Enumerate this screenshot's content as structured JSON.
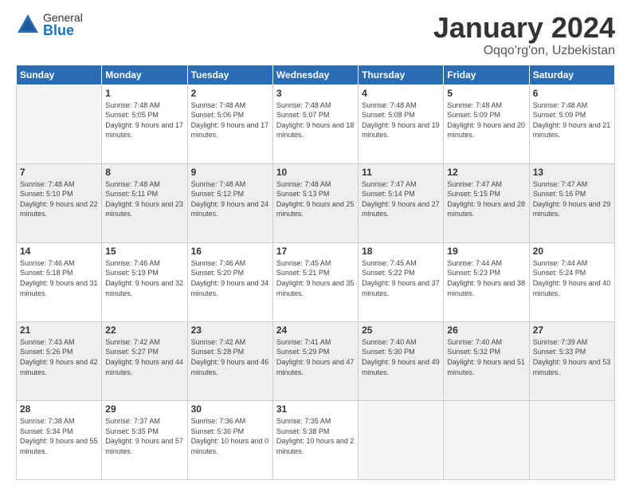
{
  "logo": {
    "general": "General",
    "blue": "Blue"
  },
  "title": {
    "month_year": "January 2024",
    "location": "Oqqo'rg'on, Uzbekistan"
  },
  "headers": [
    "Sunday",
    "Monday",
    "Tuesday",
    "Wednesday",
    "Thursday",
    "Friday",
    "Saturday"
  ],
  "weeks": [
    [
      {
        "day": "",
        "sunrise": "",
        "sunset": "",
        "daylight": ""
      },
      {
        "day": "1",
        "sunrise": "Sunrise: 7:48 AM",
        "sunset": "Sunset: 5:05 PM",
        "daylight": "Daylight: 9 hours and 17 minutes."
      },
      {
        "day": "2",
        "sunrise": "Sunrise: 7:48 AM",
        "sunset": "Sunset: 5:06 PM",
        "daylight": "Daylight: 9 hours and 17 minutes."
      },
      {
        "day": "3",
        "sunrise": "Sunrise: 7:48 AM",
        "sunset": "Sunset: 5:07 PM",
        "daylight": "Daylight: 9 hours and 18 minutes."
      },
      {
        "day": "4",
        "sunrise": "Sunrise: 7:48 AM",
        "sunset": "Sunset: 5:08 PM",
        "daylight": "Daylight: 9 hours and 19 minutes."
      },
      {
        "day": "5",
        "sunrise": "Sunrise: 7:48 AM",
        "sunset": "Sunset: 5:09 PM",
        "daylight": "Daylight: 9 hours and 20 minutes."
      },
      {
        "day": "6",
        "sunrise": "Sunrise: 7:48 AM",
        "sunset": "Sunset: 5:09 PM",
        "daylight": "Daylight: 9 hours and 21 minutes."
      }
    ],
    [
      {
        "day": "7",
        "sunrise": "Sunrise: 7:48 AM",
        "sunset": "Sunset: 5:10 PM",
        "daylight": "Daylight: 9 hours and 22 minutes."
      },
      {
        "day": "8",
        "sunrise": "Sunrise: 7:48 AM",
        "sunset": "Sunset: 5:11 PM",
        "daylight": "Daylight: 9 hours and 23 minutes."
      },
      {
        "day": "9",
        "sunrise": "Sunrise: 7:48 AM",
        "sunset": "Sunset: 5:12 PM",
        "daylight": "Daylight: 9 hours and 24 minutes."
      },
      {
        "day": "10",
        "sunrise": "Sunrise: 7:48 AM",
        "sunset": "Sunset: 5:13 PM",
        "daylight": "Daylight: 9 hours and 25 minutes."
      },
      {
        "day": "11",
        "sunrise": "Sunrise: 7:47 AM",
        "sunset": "Sunset: 5:14 PM",
        "daylight": "Daylight: 9 hours and 27 minutes."
      },
      {
        "day": "12",
        "sunrise": "Sunrise: 7:47 AM",
        "sunset": "Sunset: 5:15 PM",
        "daylight": "Daylight: 9 hours and 28 minutes."
      },
      {
        "day": "13",
        "sunrise": "Sunrise: 7:47 AM",
        "sunset": "Sunset: 5:16 PM",
        "daylight": "Daylight: 9 hours and 29 minutes."
      }
    ],
    [
      {
        "day": "14",
        "sunrise": "Sunrise: 7:46 AM",
        "sunset": "Sunset: 5:18 PM",
        "daylight": "Daylight: 9 hours and 31 minutes."
      },
      {
        "day": "15",
        "sunrise": "Sunrise: 7:46 AM",
        "sunset": "Sunset: 5:19 PM",
        "daylight": "Daylight: 9 hours and 32 minutes."
      },
      {
        "day": "16",
        "sunrise": "Sunrise: 7:46 AM",
        "sunset": "Sunset: 5:20 PM",
        "daylight": "Daylight: 9 hours and 34 minutes."
      },
      {
        "day": "17",
        "sunrise": "Sunrise: 7:45 AM",
        "sunset": "Sunset: 5:21 PM",
        "daylight": "Daylight: 9 hours and 35 minutes."
      },
      {
        "day": "18",
        "sunrise": "Sunrise: 7:45 AM",
        "sunset": "Sunset: 5:22 PM",
        "daylight": "Daylight: 9 hours and 37 minutes."
      },
      {
        "day": "19",
        "sunrise": "Sunrise: 7:44 AM",
        "sunset": "Sunset: 5:23 PM",
        "daylight": "Daylight: 9 hours and 38 minutes."
      },
      {
        "day": "20",
        "sunrise": "Sunrise: 7:44 AM",
        "sunset": "Sunset: 5:24 PM",
        "daylight": "Daylight: 9 hours and 40 minutes."
      }
    ],
    [
      {
        "day": "21",
        "sunrise": "Sunrise: 7:43 AM",
        "sunset": "Sunset: 5:26 PM",
        "daylight": "Daylight: 9 hours and 42 minutes."
      },
      {
        "day": "22",
        "sunrise": "Sunrise: 7:42 AM",
        "sunset": "Sunset: 5:27 PM",
        "daylight": "Daylight: 9 hours and 44 minutes."
      },
      {
        "day": "23",
        "sunrise": "Sunrise: 7:42 AM",
        "sunset": "Sunset: 5:28 PM",
        "daylight": "Daylight: 9 hours and 46 minutes."
      },
      {
        "day": "24",
        "sunrise": "Sunrise: 7:41 AM",
        "sunset": "Sunset: 5:29 PM",
        "daylight": "Daylight: 9 hours and 47 minutes."
      },
      {
        "day": "25",
        "sunrise": "Sunrise: 7:40 AM",
        "sunset": "Sunset: 5:30 PM",
        "daylight": "Daylight: 9 hours and 49 minutes."
      },
      {
        "day": "26",
        "sunrise": "Sunrise: 7:40 AM",
        "sunset": "Sunset: 5:32 PM",
        "daylight": "Daylight: 9 hours and 51 minutes."
      },
      {
        "day": "27",
        "sunrise": "Sunrise: 7:39 AM",
        "sunset": "Sunset: 5:33 PM",
        "daylight": "Daylight: 9 hours and 53 minutes."
      }
    ],
    [
      {
        "day": "28",
        "sunrise": "Sunrise: 7:38 AM",
        "sunset": "Sunset: 5:34 PM",
        "daylight": "Daylight: 9 hours and 55 minutes."
      },
      {
        "day": "29",
        "sunrise": "Sunrise: 7:37 AM",
        "sunset": "Sunset: 5:35 PM",
        "daylight": "Daylight: 9 hours and 57 minutes."
      },
      {
        "day": "30",
        "sunrise": "Sunrise: 7:36 AM",
        "sunset": "Sunset: 5:36 PM",
        "daylight": "Daylight: 10 hours and 0 minutes."
      },
      {
        "day": "31",
        "sunrise": "Sunrise: 7:35 AM",
        "sunset": "Sunset: 5:38 PM",
        "daylight": "Daylight: 10 hours and 2 minutes."
      },
      {
        "day": "",
        "sunrise": "",
        "sunset": "",
        "daylight": ""
      },
      {
        "day": "",
        "sunrise": "",
        "sunset": "",
        "daylight": ""
      },
      {
        "day": "",
        "sunrise": "",
        "sunset": "",
        "daylight": ""
      }
    ]
  ]
}
